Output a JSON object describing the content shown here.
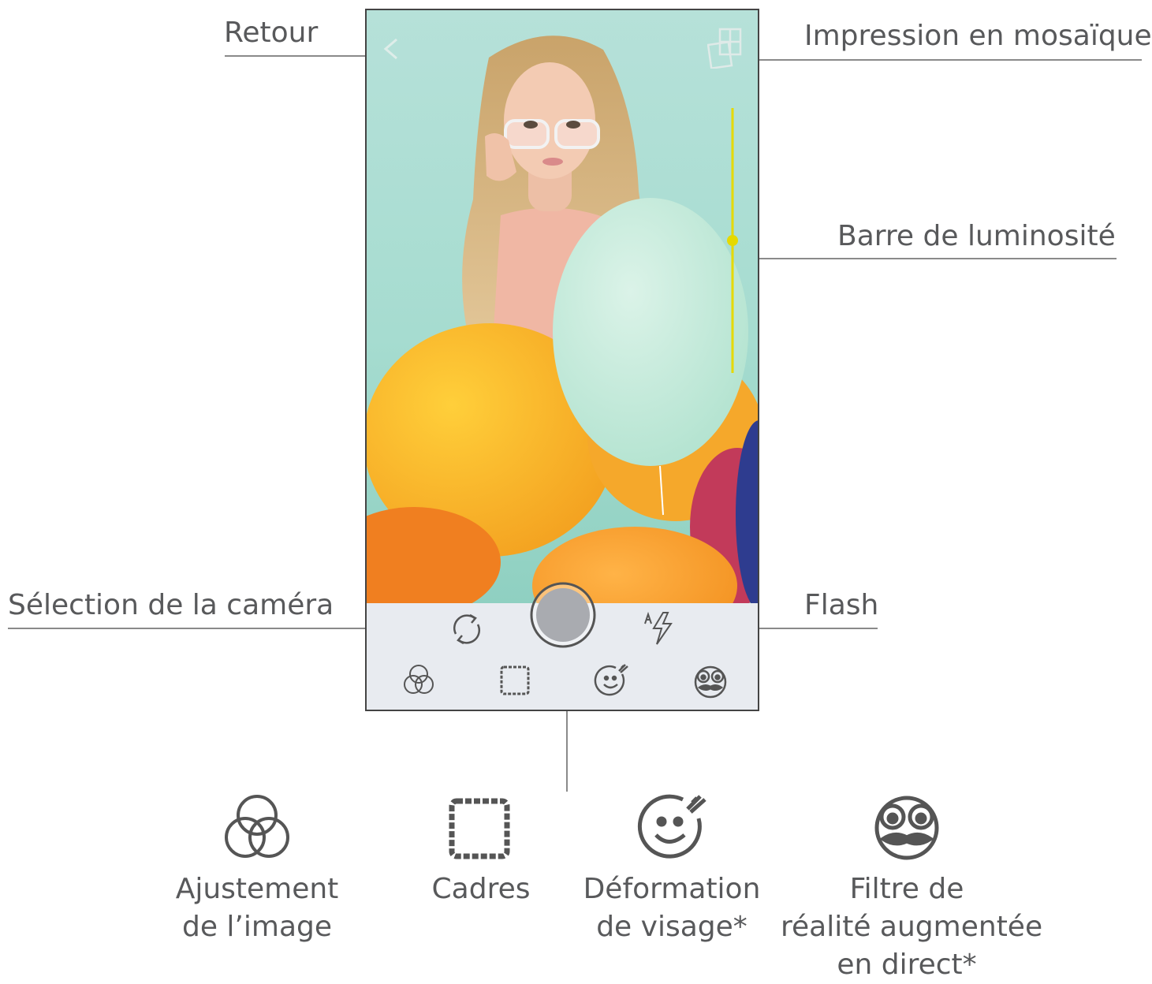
{
  "callouts": {
    "back": "Retour",
    "mosaic": "Impression en mosaïque",
    "brightness": "Barre de luminosité",
    "camera_select": "Sélection de la caméra",
    "flash": "Flash"
  },
  "legend": {
    "adjust": [
      "Ajustement",
      "de l’image"
    ],
    "frames": [
      "Cadres"
    ],
    "face_warp": [
      "Déformation",
      "de visage*"
    ],
    "ar_filter": [
      "Filtre de",
      "réalité augmentée",
      "en direct*"
    ]
  },
  "brightness_level": 0.5,
  "colors": {
    "label_text": "#58595b",
    "brightness_bar": "#e6d900",
    "icon_stroke": "#555555",
    "toolbar_bg": "#e8ebf0",
    "photo_bg": "#a8ddd1"
  }
}
